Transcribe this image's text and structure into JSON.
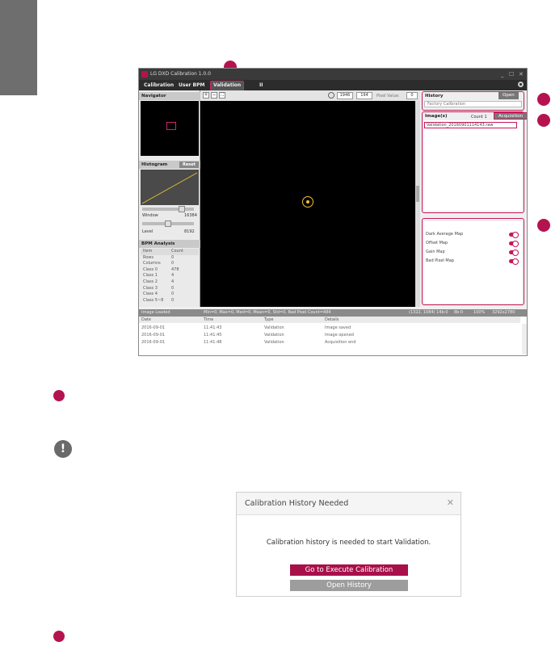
{
  "app": {
    "title": "LG DXD Calibration 1.0.0",
    "menu": [
      "Calibration",
      "User BPM",
      "Validation",
      "II"
    ],
    "window_buttons": {
      "minimize": "_",
      "maximize": "☐",
      "close": "✕"
    }
  },
  "left": {
    "navigator_label": "Navigator",
    "histogram_label": "Histogram",
    "reset_label": "Reset",
    "window_label": "Window",
    "window_value": "16384",
    "window_level": 0.8,
    "level_label": "Level",
    "level_value": "8192",
    "level_position": 0.5,
    "bpm_label": "BPM Analysis",
    "bpm_headers": [
      "Item",
      "Count"
    ],
    "bpm_rows": [
      [
        "Rows",
        "0"
      ],
      [
        "Columns",
        "0"
      ],
      [
        "Class 0",
        "478"
      ],
      [
        "Class 1",
        "4"
      ],
      [
        "Class 2",
        "4"
      ],
      [
        "Class 3",
        "0"
      ],
      [
        "Class 4",
        "0"
      ],
      [
        "Class 5~8",
        "0"
      ]
    ]
  },
  "toolbar": {
    "zoom_in": "+",
    "zoom_out": "−",
    "fit": "⛶",
    "width": "1946",
    "height": "194",
    "pixel_value_label": "Pixel Value:",
    "pixel_value": "0"
  },
  "right": {
    "history_label": "History",
    "open_label": "Open",
    "history_select": "Factory Calibration",
    "images_label": "Image(s)",
    "count_label": "Count 1",
    "acquisition_label": "Acquisition",
    "image_item": "Validation_20160901114143.raw",
    "maps": [
      "Dark Average Map",
      "Offset Map",
      "Gain Map",
      "Bad Pixel Map"
    ]
  },
  "status": {
    "left": "Image Loaded",
    "middle": "Min=0, Max=0, Med=0, Mean=0, Std=0, Bad Pixel Count=484",
    "r1": "(1322, 1084) 14b:0",
    "r2": "8b:0",
    "r3": "100%",
    "r4": "3292x2780"
  },
  "log": {
    "headers": [
      "Date",
      "Time",
      "Type",
      "Details"
    ],
    "rows": [
      [
        "2016-09-01",
        "11:41:43",
        "Validation",
        "Image saved"
      ],
      [
        "2016-09-01",
        "11:41:45",
        "Validation",
        "Image opened"
      ],
      [
        "2016-09-01",
        "11:41:48",
        "Validation",
        "Acquisition end"
      ]
    ]
  },
  "dialog": {
    "title": "Calibration History Needed",
    "close": "✕",
    "message": "Calibration history is needed to start Validation.",
    "primary": "Go to Execute Calibration",
    "secondary": "Open History"
  },
  "notice_icon": "!",
  "colors": {
    "accent": "#b5134f",
    "dialog_primary": "#a8104a",
    "dialog_secondary": "#9d9d9d"
  }
}
